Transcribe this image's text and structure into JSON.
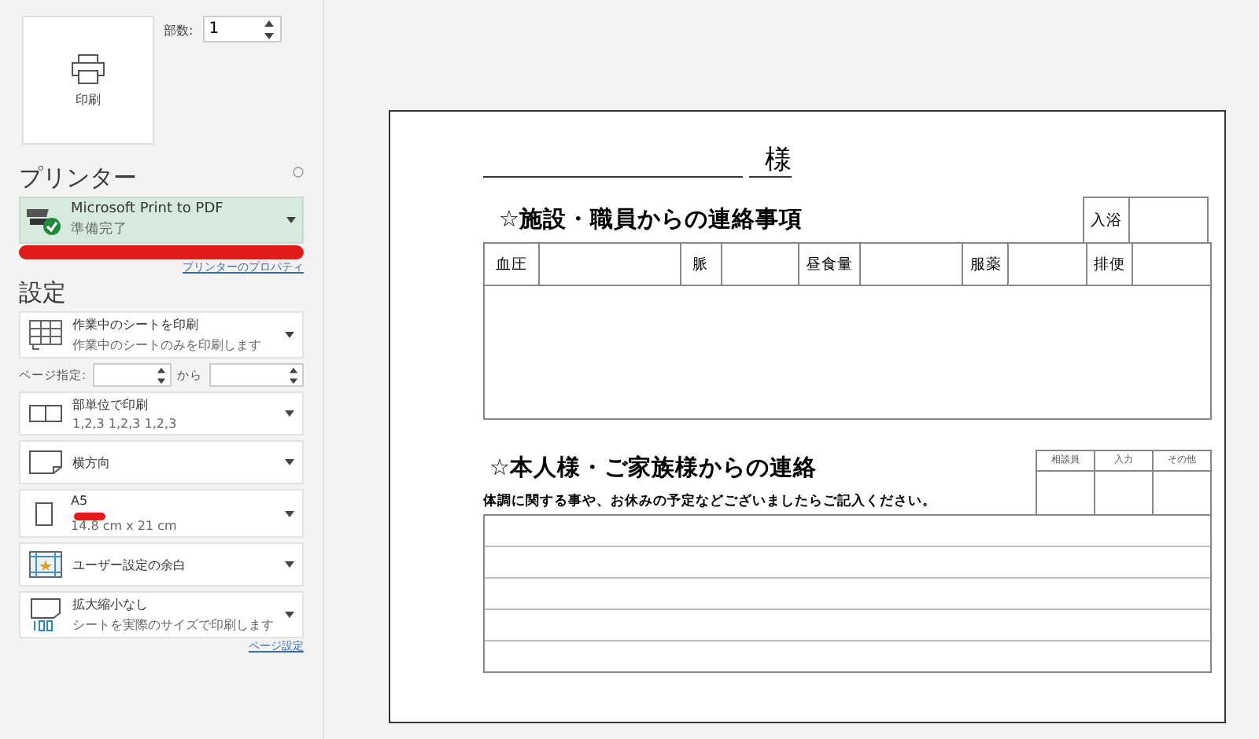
{
  "print_button": {
    "label": "印刷"
  },
  "copies": {
    "label": "部数:",
    "value": "1"
  },
  "printer_section": {
    "title": "プリンター",
    "printer": {
      "name": "Microsoft Print to PDF",
      "status": "準備完了"
    },
    "properties_link": "プリンターのプロパティ"
  },
  "settings_section": {
    "title": "設定",
    "options": [
      {
        "kind": "dropdown",
        "title": "作業中のシートを印刷",
        "subtitle": "作業中のシートのみを印刷します"
      },
      {
        "kind": "pages",
        "label": "ページ指定:",
        "to_label": "から"
      },
      {
        "kind": "dropdown",
        "title": "部単位で印刷",
        "subtitle": "1,2,3    1,2,3    1,2,3"
      },
      {
        "kind": "dropdown",
        "title": "横方向"
      },
      {
        "kind": "dropdown",
        "title": "A5",
        "subtitle": "14.8 cm x 21 cm"
      },
      {
        "kind": "dropdown",
        "title": "ユーザー設定の余白"
      },
      {
        "kind": "dropdown",
        "title": "拡大縮小なし",
        "subtitle": "シートを実際のサイズで印刷します"
      }
    ],
    "page_setup_link": "ページ設定"
  },
  "preview": {
    "name_suffix": "様",
    "staff_section": {
      "title": "☆施設・職員からの連絡事項",
      "bath_label": "入浴",
      "vitals": [
        "血圧",
        "脈",
        "昼食量",
        "服薬",
        "排便"
      ]
    },
    "family_section": {
      "title": "☆本人様・ご家族様からの連絡",
      "note": "体調に関する事や、お休みの予定などございましたらご記入ください。",
      "stamp_columns": [
        "相談員",
        "入力",
        "その他"
      ]
    }
  }
}
